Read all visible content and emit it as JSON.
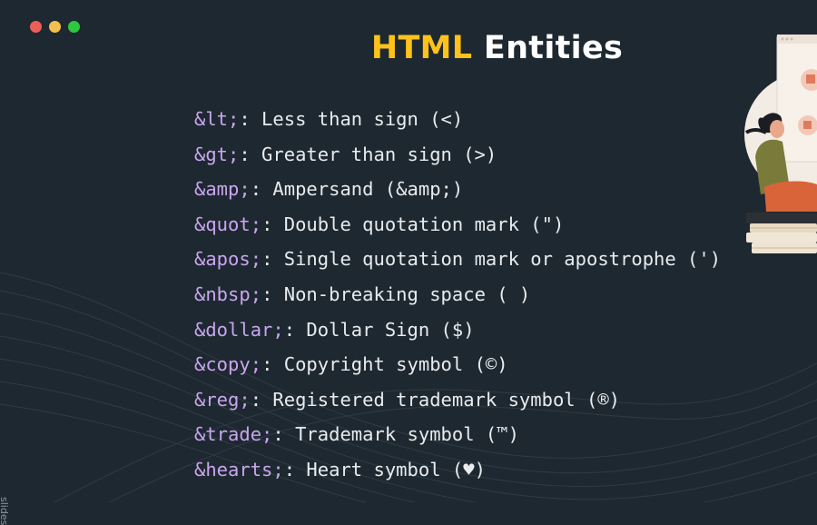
{
  "window_controls": [
    {
      "name": "close",
      "color": "#ec5f57"
    },
    {
      "name": "minimize",
      "color": "#f4bf4f"
    },
    {
      "name": "maximize",
      "color": "#2ec840"
    }
  ],
  "title": {
    "part1": "HTML",
    "part2": "Entities",
    "accent_color": "#ffc21a"
  },
  "entities": [
    {
      "code": "&lt;",
      "desc": " Less than sign (<)"
    },
    {
      "code": "&gt;",
      "desc": " Greater than sign (>)"
    },
    {
      "code": "&amp;",
      "desc": " Ampersand (&amp;)"
    },
    {
      "code": "&quot;",
      "desc": " Double quotation mark (\")"
    },
    {
      "code": "&apos;",
      "desc": " Single quotation mark or apostrophe (')"
    },
    {
      "code": "&nbsp;",
      "desc": " Non-breaking space ( )"
    },
    {
      "code": "&dollar;",
      "desc": " Dollar Sign ($)"
    },
    {
      "code": "&copy;",
      "desc": " Copyright symbol (©)"
    },
    {
      "code": "&reg;",
      "desc": " Registered trademark symbol (®)"
    },
    {
      "code": "&trade;",
      "desc": " Trademark symbol (™)"
    },
    {
      "code": "&hearts;",
      "desc": " Heart symbol (♥)"
    }
  ],
  "side_label": "slides"
}
